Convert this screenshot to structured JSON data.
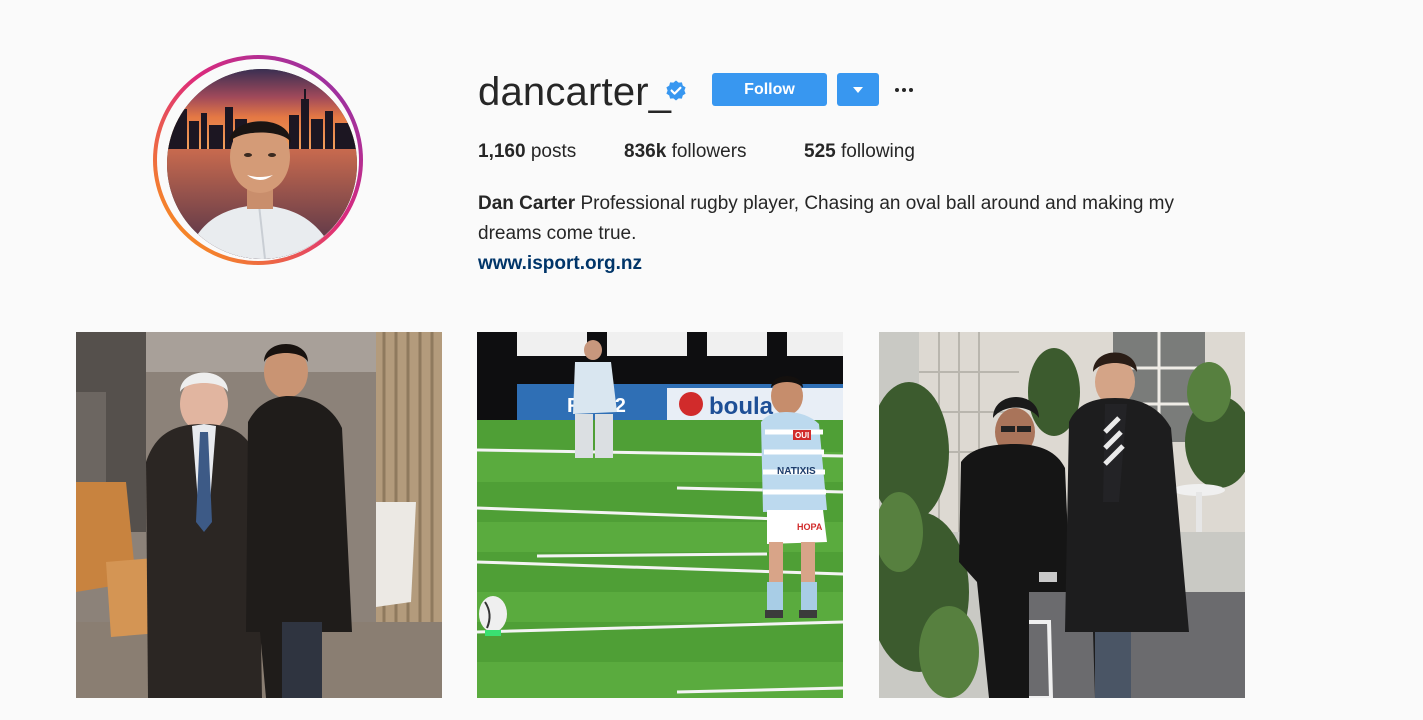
{
  "profile": {
    "username": "dancarter_",
    "verified": true,
    "follow_label": "Follow",
    "stats": {
      "posts_count": "1,160",
      "posts_label": "posts",
      "followers_count": "836k",
      "followers_label": "followers",
      "following_count": "525",
      "following_label": "following"
    },
    "bio": {
      "full_name": "Dan Carter",
      "text": "Professional rugby player, Chasing an oval ball around and making my dreams come true.",
      "website": "www.isport.org.nz"
    }
  },
  "posts": {
    "post_1": {
      "signage_label": ""
    },
    "post_2": {
      "banner_text_1": "F      S 92",
      "banner_text_2": "boula",
      "shirt_text_1": "OUI",
      "shirt_text_2": "NATIXIS",
      "shorts_text": "HOPA"
    }
  },
  "colors": {
    "accent": "#3897f0",
    "link": "#003569",
    "background": "#fafafa",
    "text": "#262626",
    "story_ring_start": "#f58529",
    "story_ring_end": "#8134af"
  },
  "icons": {
    "verified": "verified-badge-icon",
    "dropdown": "caret-down-icon",
    "more": "more-options-icon"
  }
}
